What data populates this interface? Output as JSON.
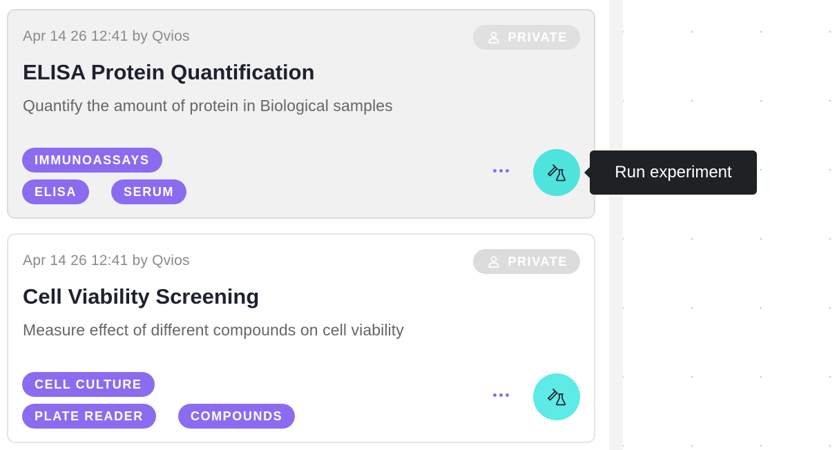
{
  "cards": [
    {
      "date": "Apr 14 26 12:41",
      "author": "by Qvios",
      "visibility": "PRIVATE",
      "title": "ELISA Protein Quantification",
      "description": "Quantify the amount of protein in Biological samples",
      "tags": [
        "IMMUNOASSAYS",
        "ELISA",
        "SERUM"
      ]
    },
    {
      "date": "Apr 14 26 12:41",
      "author": "by Qvios",
      "visibility": "PRIVATE",
      "title": "Cell Viability Screening",
      "description": "Measure effect of different compounds on cell viability",
      "tags": [
        "CELL CULTURE",
        "PLATE READER",
        "COMPOUNDS"
      ]
    }
  ],
  "tooltip": "Run experiment",
  "icons": {
    "visibility": "person-icon",
    "run": "flask-test-tube-icon",
    "more": "more-horizontal-icon"
  },
  "colors": {
    "tag": "#8b6cf0",
    "run_button": "#5eeae6",
    "badge": "#dcdcdc",
    "tooltip": "#1f2224"
  }
}
